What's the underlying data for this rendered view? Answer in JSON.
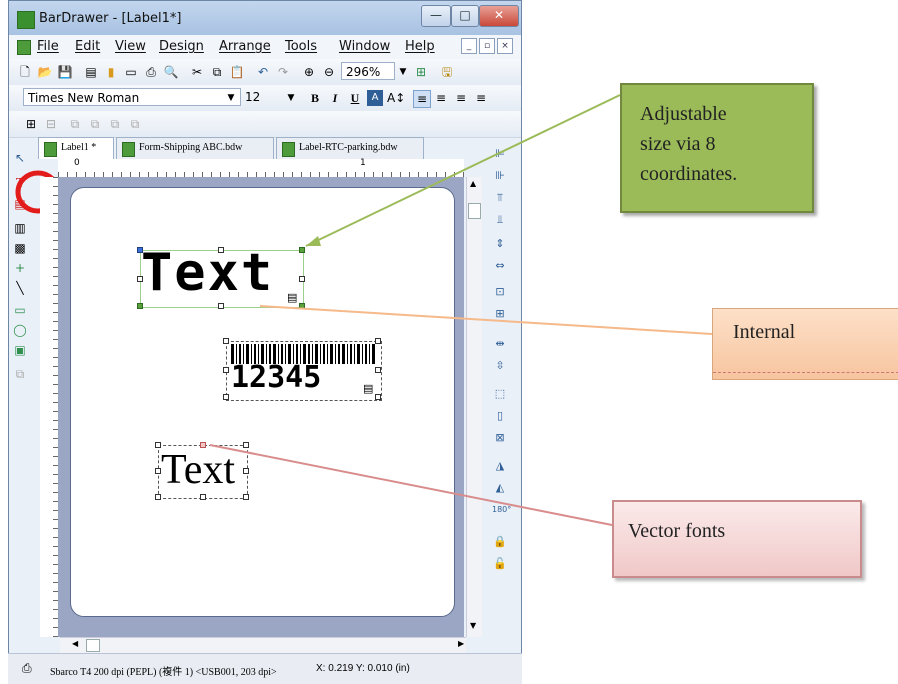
{
  "window": {
    "title": "BarDrawer - [Label1*]"
  },
  "window_controls": {
    "minimize": "—",
    "maximize": "□",
    "close": "✕"
  },
  "menu": [
    "File",
    "Edit",
    "View",
    "Design",
    "Arrange",
    "Tools",
    "Window",
    "Help"
  ],
  "mdi_controls": {
    "minimize": "_",
    "restore": "▫",
    "close": "×"
  },
  "toolbar": {
    "zoom": "296%"
  },
  "format_bar": {
    "font_name": "Times New Roman",
    "font_size": "12",
    "bold": "B",
    "italic": "I",
    "underline": "U"
  },
  "tabs": [
    {
      "label": "Label1 *"
    },
    {
      "label": "Form-Shipping ABC.bdw"
    },
    {
      "label": "Label-RTC-parking.bdw"
    }
  ],
  "ruler": {
    "mark_0": "0",
    "mark_1": "1"
  },
  "canvas": {
    "text_internal": "Text",
    "barcode_number": "12345",
    "text_vector": "Text"
  },
  "status": {
    "printer": "Sbarco T4 200 dpi (PEPL) (複件 1) <USB001, 203 dpi>",
    "coords": "X: 0.219  Y: 0.010 (in)"
  },
  "callouts": {
    "adjustable": [
      "Adjustable",
      "size via 8",
      "coordinates."
    ],
    "internal": "Internal",
    "vector": "Vector fonts"
  },
  "colors": {
    "callout_green": "#9bbb59",
    "callout_pink": "#f2d6d6",
    "highlight_circle": "#e21b1b"
  }
}
